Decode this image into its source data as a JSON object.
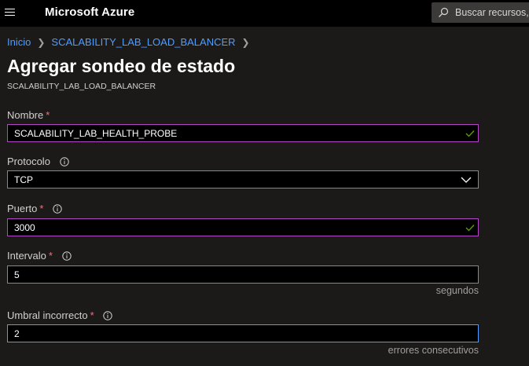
{
  "header": {
    "brand": "Microsoft Azure",
    "search_placeholder": "Buscar recursos,"
  },
  "breadcrumb": {
    "items": [
      "Inicio",
      "SCALABILITY_LAB_LOAD_BALANCER"
    ]
  },
  "page": {
    "title": "Agregar sondeo de estado",
    "subtitle": "SCALABILITY_LAB_LOAD_BALANCER"
  },
  "form": {
    "nombre": {
      "label": "Nombre",
      "required": "*",
      "value": "SCALABILITY_LAB_HEALTH_PROBE"
    },
    "protocolo": {
      "label": "Protocolo",
      "value": "TCP"
    },
    "puerto": {
      "label": "Puerto",
      "required": "*",
      "value": "3000"
    },
    "intervalo": {
      "label": "Intervalo",
      "required": "*",
      "value": "5",
      "hint": "segundos"
    },
    "umbral": {
      "label": "Umbral incorrecto",
      "required": "*",
      "value": "2",
      "hint": "errores consecutivos"
    }
  },
  "colors": {
    "link": "#4f9cff",
    "required": "#f1707b",
    "valid_border": "#b146c2",
    "focus_border": "#4f9cff",
    "check": "#57a300"
  }
}
